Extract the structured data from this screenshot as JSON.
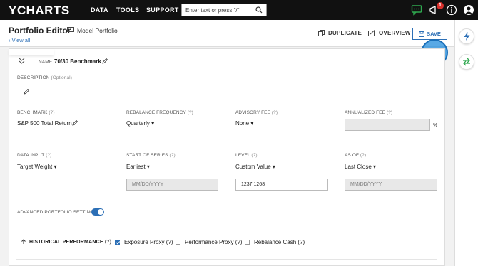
{
  "nav": {
    "logo": "YCHARTS",
    "items": [
      "DATA",
      "TOOLS",
      "SUPPORT"
    ],
    "search_placeholder": "Enter text or press \"/\"",
    "notification_count": "1"
  },
  "header": {
    "title": "Portfolio Editor",
    "model_label": "Model Portfolio",
    "view_all": "View all",
    "duplicate": "DUPLICATE",
    "overview": "OVERVIEW",
    "save": "SAVE"
  },
  "panel": {
    "name_label": "NAME",
    "name_value": "70/30 Benchmark",
    "description_label": "DESCRIPTION",
    "description_optional": "(Optional)",
    "benchmark_label": "BENCHMARK",
    "benchmark_value": "S&P 500 Total Return",
    "rebalance_label": "REBALANCE FREQUENCY",
    "rebalance_value": "Quarterly",
    "advisory_label": "ADVISORY FEE",
    "advisory_value": "None",
    "annualized_label": "ANNUALIZED FEE",
    "annualized_suffix": "%",
    "data_input_label": "DATA INPUT",
    "data_input_value": "Target Weight",
    "start_label": "START OF SERIES",
    "start_value": "Earliest",
    "start_placeholder": "MM/DD/YYYY",
    "level_label": "LEVEL",
    "level_value": "Custom Value",
    "level_input": "1237.1268",
    "asof_label": "AS OF",
    "asof_value": "Last Close",
    "asof_placeholder": "MM/DD/YYYY",
    "advanced_label": "ADVANCED PORTFOLIO SETTINGS",
    "historical_label": "HISTORICAL PERFORMANCE",
    "exposure_proxy": "Exposure Proxy (?)",
    "performance_proxy": "Performance Proxy (?)",
    "rebalance_cash": "Rebalance Cash (?)",
    "help": "(?)"
  },
  "colors": {
    "accent": "#2c6fb6",
    "nav_bg": "#111111",
    "badge": "#d9302c",
    "green": "#2fa84f"
  },
  "icons": [
    "search-icon",
    "chat-icon",
    "megaphone-icon",
    "info-icon",
    "user-icon",
    "duplicate-icon",
    "overview-icon",
    "save-icon",
    "pencil-icon",
    "chevron-down-icon",
    "lightning-icon",
    "swap-icon",
    "upload-icon"
  ]
}
